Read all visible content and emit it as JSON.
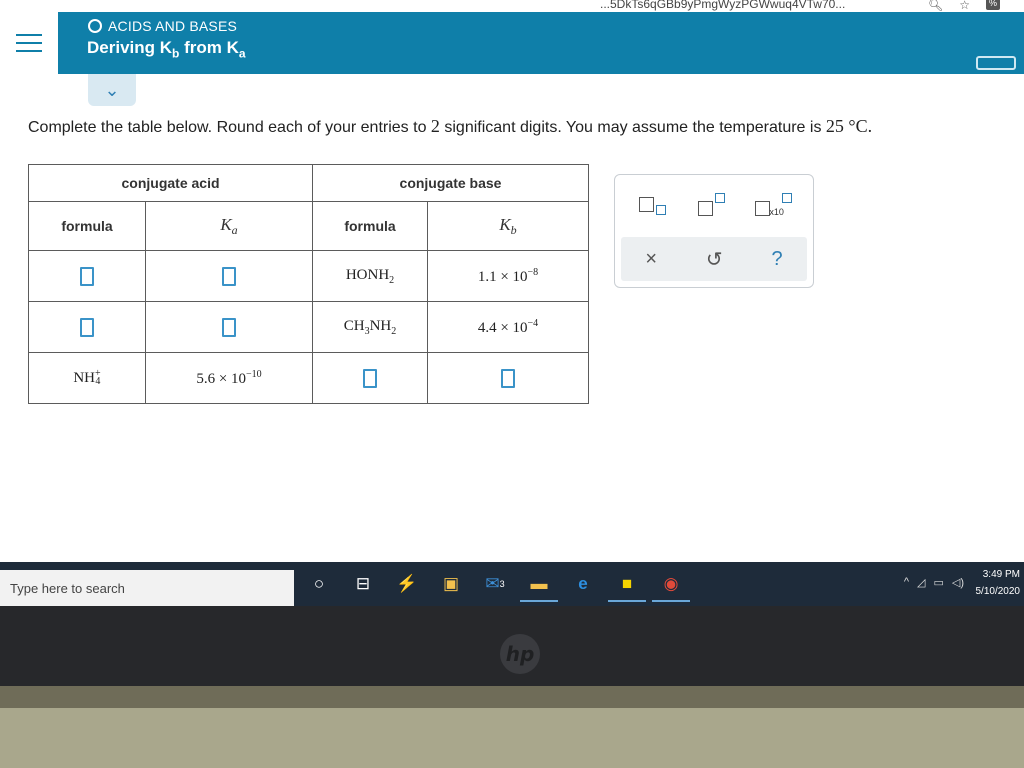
{
  "browser": {
    "url_fragment": "...5DkTs6qGBb9yPmgWyzPGWwuq4VTw70...",
    "zoom_icon": "magnifier-icon",
    "bookmark_icon": "star-icon"
  },
  "header": {
    "topic": "ACIDS AND BASES",
    "title_main": "Deriving K",
    "title_sub_b": "b",
    "title_from": " from K",
    "title_sub_a": "a",
    "menu_icon": "hamburger-icon"
  },
  "content": {
    "collapse_icon": "chevron-down-icon",
    "instructions_pre": "Complete the table below. Round each of your entries to ",
    "instructions_digits": "2",
    "instructions_post": " significant digits. You may assume the temperature is ",
    "temperature": "25 °C."
  },
  "table": {
    "group_headers": [
      "conjugate acid",
      "conjugate base"
    ],
    "sub_headers": {
      "acid_formula": "formula",
      "ka_symbol": "K",
      "ka_sub": "a",
      "base_formula": "formula",
      "kb_symbol": "K",
      "kb_sub": "b"
    },
    "rows": [
      {
        "acid_formula": "",
        "ka": "",
        "base_formula": {
          "main": "HONH",
          "sub": "2"
        },
        "kb": {
          "mantissa": "1.1 × 10",
          "exp": "−8"
        }
      },
      {
        "acid_formula": "",
        "ka": "",
        "base_formula": {
          "main_a": "CH",
          "sub_a": "3",
          "main_b": "NH",
          "sub_b": "2"
        },
        "kb": {
          "mantissa": "4.4 × 10",
          "exp": "−4"
        }
      },
      {
        "acid_formula": {
          "main": "NH",
          "sup": "+",
          "sub": "4"
        },
        "ka": {
          "mantissa": "5.6 × 10",
          "exp": "−10"
        },
        "base_formula": "",
        "kb": ""
      }
    ]
  },
  "palette": {
    "tools": [
      "subscript-template-icon",
      "superscript-template-icon",
      "scientific-notation-icon"
    ],
    "x10_label": "x10",
    "actions": {
      "clear": "×",
      "undo": "↺",
      "help": "?"
    }
  },
  "taskbar": {
    "search_placeholder": "Type here to search",
    "icons": [
      "cortana-icon",
      "task-view-icon",
      "lightning-app-icon",
      "store-icon",
      "mail-icon",
      "file-explorer-icon",
      "edge-icon",
      "sticky-notes-icon",
      "chrome-icon"
    ],
    "mail_badge": "3",
    "time": "3:49 PM",
    "date": "5/10/2020"
  },
  "device": {
    "logo": "hp"
  }
}
